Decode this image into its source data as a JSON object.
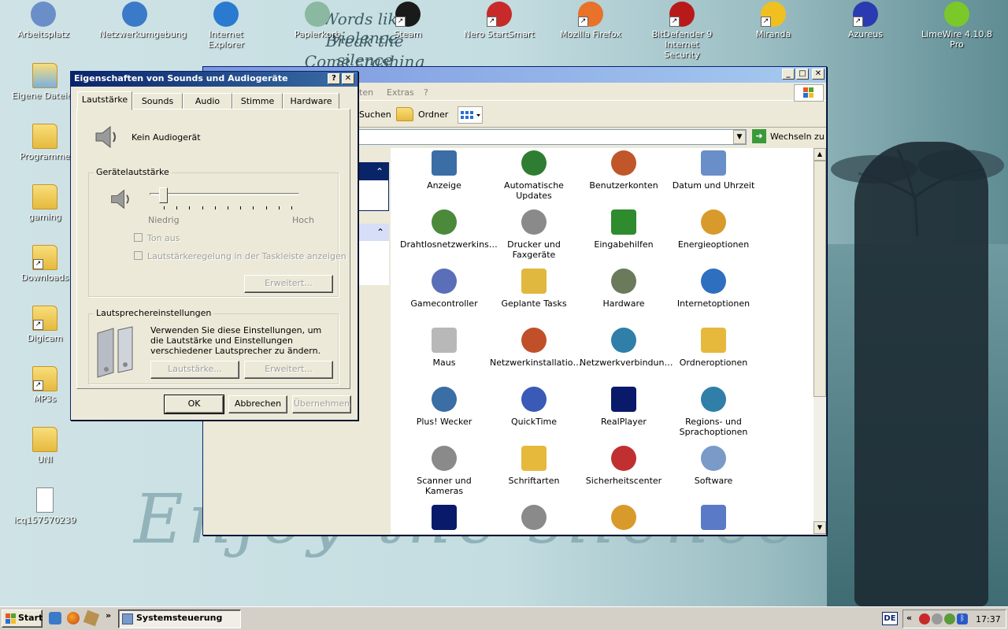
{
  "desktop": {
    "wallpaper": {
      "lyric_lines": [
        "Words like violence",
        "Break the silence",
        "Come crashing in"
      ],
      "big_text": "Enjoy the silence"
    },
    "top_icons": [
      {
        "label": "Arbeitsplatz",
        "icon": "computer-icon"
      },
      {
        "label": "Netzwerkumgebung",
        "icon": "network-places-icon"
      },
      {
        "label": "Internet Explorer",
        "icon": "internet-explorer-icon"
      },
      {
        "label": "Papierkorb",
        "icon": "recycle-bin-icon"
      },
      {
        "label": "Steam",
        "icon": "steam-icon"
      },
      {
        "label": "Nero StartSmart",
        "icon": "nero-icon"
      },
      {
        "label": "Mozilla Firefox",
        "icon": "firefox-icon"
      },
      {
        "label": "BitDefender 9 Internet Security",
        "icon": "bitdefender-icon"
      },
      {
        "label": "Miranda",
        "icon": "miranda-icon"
      },
      {
        "label": "Azureus",
        "icon": "azureus-icon"
      },
      {
        "label": "LimeWire 4.10.8 Pro",
        "icon": "limewire-icon"
      }
    ],
    "left_icons": [
      {
        "label": "Eigene Dateien",
        "icon": "my-documents-icon"
      },
      {
        "label": "Programme",
        "icon": "folder-icon"
      },
      {
        "label": "gaming",
        "icon": "folder-icon"
      },
      {
        "label": "Downloads",
        "icon": "folder-shortcut-icon"
      },
      {
        "label": "Digicam",
        "icon": "folder-shortcut-icon"
      },
      {
        "label": "MP3s",
        "icon": "folder-shortcut-icon"
      },
      {
        "label": "UNI",
        "icon": "folder-icon"
      },
      {
        "label": "icq157570239",
        "icon": "text-file-icon"
      }
    ]
  },
  "control_panel": {
    "menu": {
      "item_1": "iten",
      "extras": "Extras",
      "help": "?"
    },
    "toolbar": {
      "search": "Suchen",
      "folders": "Ordner"
    },
    "address": {
      "go": "Wechseln zu"
    },
    "items": [
      {
        "label": "Anzeige",
        "icon": "display-icon",
        "color": "#3a6ea5"
      },
      {
        "label": "Automatische Updates",
        "icon": "windows-update-icon",
        "color": "#2f7d32"
      },
      {
        "label": "Benutzerkonten",
        "icon": "user-accounts-icon",
        "color": "#c0562a"
      },
      {
        "label": "Datum und Uhrzeit",
        "icon": "date-time-icon",
        "color": "#6a8fc8"
      },
      {
        "label": "Drahtlosnetzwerkins…",
        "icon": "wireless-icon",
        "color": "#4a8a3a"
      },
      {
        "label": "Drucker und Faxgeräte",
        "icon": "printer-icon",
        "color": "#8a8a8a"
      },
      {
        "label": "Eingabehilfen",
        "icon": "accessibility-icon",
        "color": "#2e8b2e"
      },
      {
        "label": "Energieoptionen",
        "icon": "power-icon",
        "color": "#d89a2a"
      },
      {
        "label": "Gamecontroller",
        "icon": "gamecontroller-icon",
        "color": "#5a6fb8"
      },
      {
        "label": "Geplante Tasks",
        "icon": "scheduled-tasks-icon",
        "color": "#e0b840"
      },
      {
        "label": "Hardware",
        "icon": "hardware-icon",
        "color": "#6a7a5a"
      },
      {
        "label": "Internetoptionen",
        "icon": "internet-options-icon",
        "color": "#2f6fc0"
      },
      {
        "label": "Maus",
        "icon": "mouse-icon",
        "color": "#b8b8b8"
      },
      {
        "label": "Netzwerkinstallatio…",
        "icon": "network-setup-icon",
        "color": "#c0502a"
      },
      {
        "label": "Netzwerkverbindun…",
        "icon": "network-connections-icon",
        "color": "#2f7fa8"
      },
      {
        "label": "Ordneroptionen",
        "icon": "folder-options-icon",
        "color": "#e6b93d"
      },
      {
        "label": "Plus! Wecker",
        "icon": "alarm-clock-icon",
        "color": "#3a6ea5"
      },
      {
        "label": "QuickTime",
        "icon": "quicktime-icon",
        "color": "#3a5ab8"
      },
      {
        "label": "RealPlayer",
        "icon": "realplayer-icon",
        "color": "#0a1a6a"
      },
      {
        "label": "Regions- und Sprachoptionen",
        "icon": "globe-icon",
        "color": "#2f7fa8"
      },
      {
        "label": "Scanner und Kameras",
        "icon": "scanner-icon",
        "color": "#8a8a8a"
      },
      {
        "label": "Schriftarten",
        "icon": "fonts-icon",
        "color": "#e6b93d"
      },
      {
        "label": "Sicherheitscenter",
        "icon": "security-center-icon",
        "color": "#c03030"
      },
      {
        "label": "Software",
        "icon": "software-icon",
        "color": "#7a9ac8"
      },
      {
        "label": "",
        "icon": "broadcast-icon",
        "color": "#0a1a6a"
      },
      {
        "label": "",
        "icon": "sounds-icon",
        "color": "#8a8a8a"
      },
      {
        "label": "",
        "icon": "speech-icon",
        "color": "#d89a2a"
      },
      {
        "label": "",
        "icon": "system-icon",
        "color": "#5a7ac8"
      }
    ]
  },
  "dialog": {
    "title": "Eigenschaften von Sounds und Audiogeräte",
    "tabs": [
      "Lautstärke",
      "Sounds",
      "Audio",
      "Stimme",
      "Hardware"
    ],
    "device": "Kein Audiogerät",
    "volume_group": "Gerätelautstärke",
    "low": "Niedrig",
    "high": "Hoch",
    "volume_level": 0.0,
    "mute": "Ton aus",
    "taskbar_icon": "Lautstärkeregelung in der Taskleiste anzeigen",
    "advanced": "Erweitert...",
    "speaker_group": "Lautsprechereinstellungen",
    "speaker_text": "Verwenden Sie diese Einstellungen, um die Lautstärke und Einstellungen verschiedener Lautsprecher zu ändern.",
    "speaker_volume": "Lautstärke...",
    "speaker_advanced": "Erweitert...",
    "ok": "OK",
    "cancel": "Abbrechen",
    "apply": "Übernehmen"
  },
  "taskbar": {
    "start": "Start",
    "task": "Systemsteuerung",
    "lang": "DE",
    "clock": "17:37",
    "chevron": "»",
    "tray_chevron": "«"
  }
}
